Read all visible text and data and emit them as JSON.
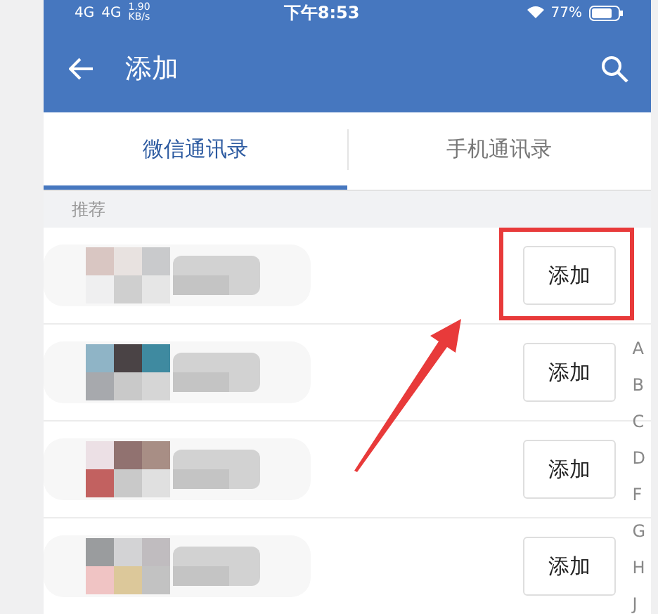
{
  "status_bar": {
    "network_1": "4G",
    "network_2": "4G",
    "speed": "1.90",
    "speed_unit": "KB/s",
    "time": "下午8:53",
    "battery": "77%"
  },
  "toolbar": {
    "title": "添加"
  },
  "tabs": [
    {
      "label": "微信通讯录",
      "selected": true
    },
    {
      "label": "手机通讯录",
      "selected": false
    }
  ],
  "section": "推荐",
  "rows": [
    {
      "kind": "picture",
      "button": "添加",
      "highlighted": true
    },
    {
      "kind": "picture",
      "button": "添加",
      "highlighted": false
    },
    {
      "kind": "picture",
      "button": "添加",
      "highlighted": false
    },
    {
      "kind": "picture",
      "button": "添加",
      "highlighted": false
    }
  ],
  "index": [
    "A",
    "B",
    "C",
    "D",
    "F",
    "G",
    "H",
    "J"
  ]
}
